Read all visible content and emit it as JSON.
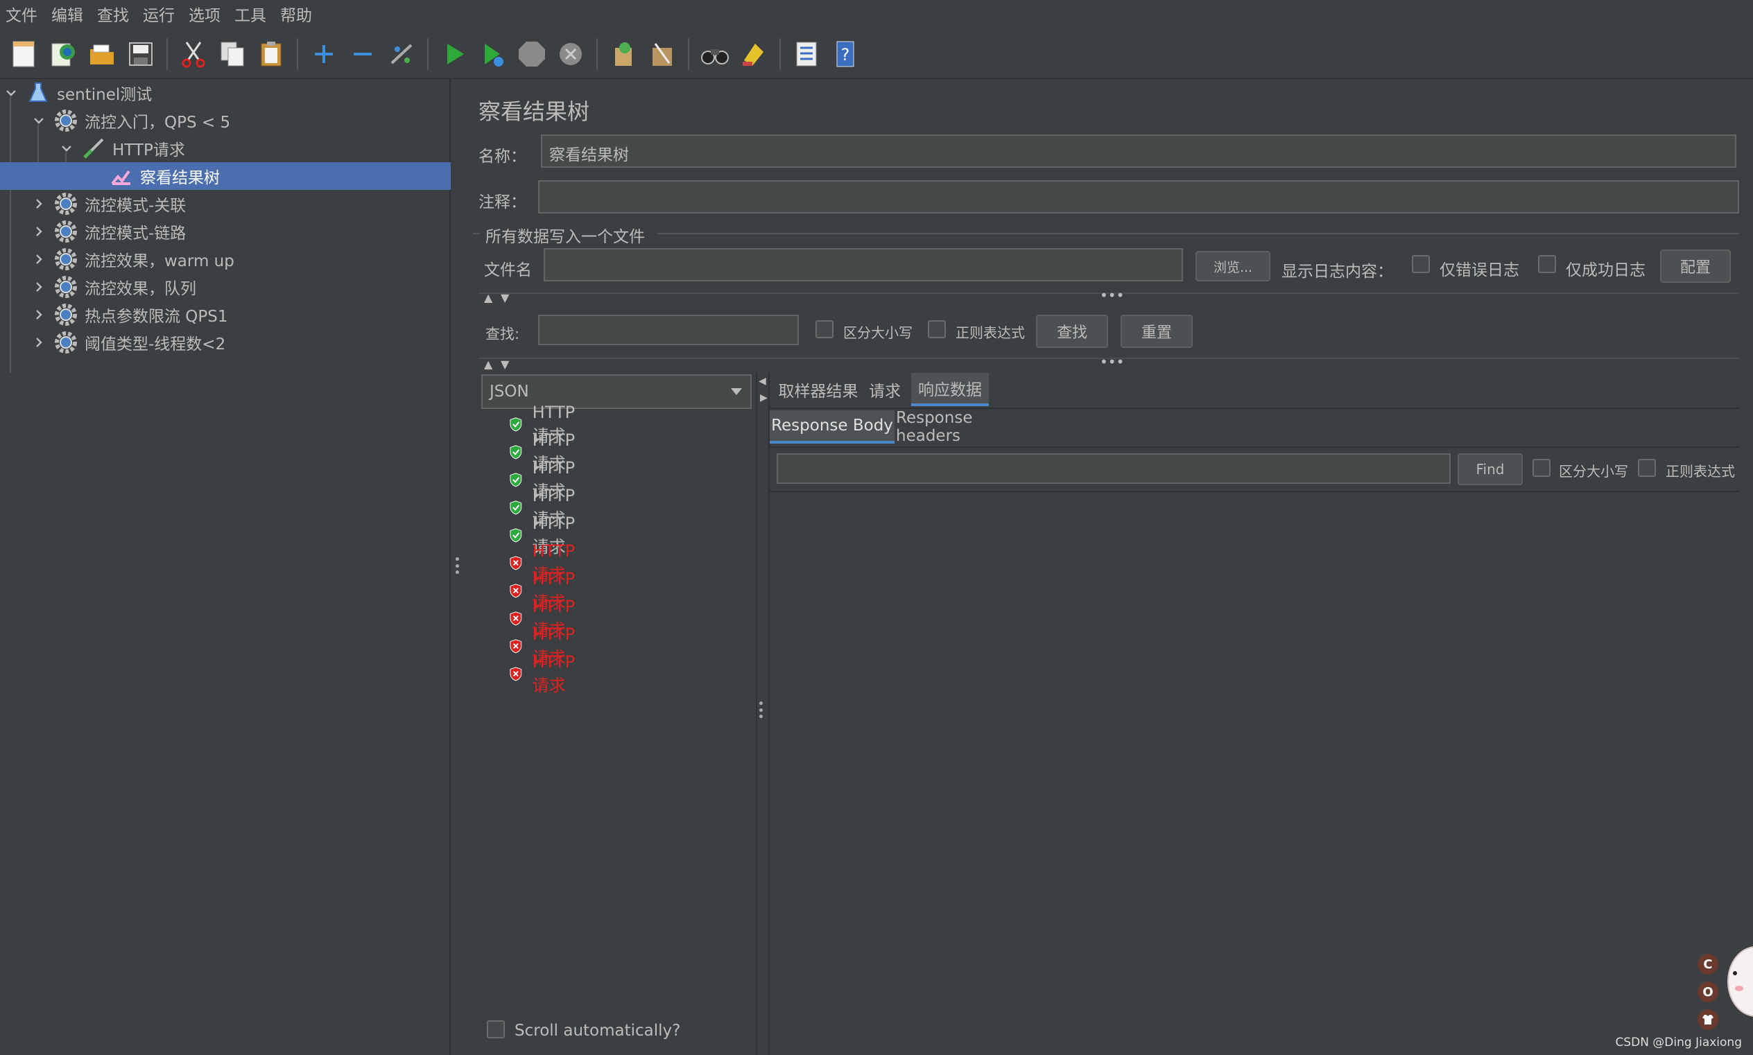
{
  "menu": [
    "文件",
    "编辑",
    "查找",
    "运行",
    "选项",
    "工具",
    "帮助"
  ],
  "toolbar": {
    "icons": [
      "new-icon",
      "templates-icon",
      "open-icon",
      "save-icon",
      "cut-icon",
      "copy-icon",
      "paste-icon",
      "expand-icon",
      "collapse-icon",
      "toggle-icon",
      "start-icon",
      "start-no-pause-icon",
      "stop-icon",
      "shutdown-icon",
      "clear-icon",
      "clear-all-icon",
      "search-icon",
      "reset-search-icon",
      "function-helper-icon",
      "help-icon"
    ]
  },
  "tree": {
    "items": [
      {
        "label": "sentinel测试",
        "level": 0,
        "expanded": true,
        "icon": "test-plan-icon"
      },
      {
        "label": "流控入门，QPS < 5",
        "level": 1,
        "expanded": true,
        "icon": "thread-group-icon"
      },
      {
        "label": "HTTP请求",
        "level": 2,
        "expanded": true,
        "icon": "sampler-icon"
      },
      {
        "label": "察看结果树",
        "level": 3,
        "selected": true,
        "icon": "listener-icon"
      },
      {
        "label": "流控模式-关联",
        "level": 1,
        "expanded": false,
        "icon": "thread-group-icon"
      },
      {
        "label": "流控模式-链路",
        "level": 1,
        "expanded": false,
        "icon": "thread-group-icon"
      },
      {
        "label": "流控效果，warm up",
        "level": 1,
        "expanded": false,
        "icon": "thread-group-icon"
      },
      {
        "label": "流控效果，队列",
        "level": 1,
        "expanded": false,
        "icon": "thread-group-icon"
      },
      {
        "label": "热点参数限流 QPS1",
        "level": 1,
        "expanded": false,
        "icon": "thread-group-icon"
      },
      {
        "label": "阈值类型-线程数<2",
        "level": 1,
        "expanded": false,
        "icon": "thread-group-icon"
      }
    ]
  },
  "panel": {
    "title": "察看结果树",
    "name_label": "名称：",
    "name_value": "察看结果树",
    "comment_label": "注释：",
    "comment_value": "",
    "file_group_label": "所有数据写入一个文件",
    "filename_label": "文件名",
    "filename_value": "",
    "browse_label": "浏览...",
    "log_display_label": "显示日志内容：",
    "errors_only_label": "仅错误日志",
    "success_only_label": "仅成功日志",
    "configure_label": "配置",
    "search_label": "查找:",
    "search_value": "",
    "case_sensitive_label": "区分大小写",
    "regex_label": "正则表达式",
    "find_label": "查找",
    "reset_label": "重置"
  },
  "results": {
    "renderer": "JSON",
    "items": [
      {
        "label": "HTTP请求",
        "status": "success"
      },
      {
        "label": "HTTP请求",
        "status": "success"
      },
      {
        "label": "HTTP请求",
        "status": "success"
      },
      {
        "label": "HTTP请求",
        "status": "success"
      },
      {
        "label": "HTTP请求",
        "status": "success"
      },
      {
        "label": "HTTP请求",
        "status": "error"
      },
      {
        "label": "HTTP请求",
        "status": "error"
      },
      {
        "label": "HTTP请求",
        "status": "error"
      },
      {
        "label": "HTTP请求",
        "status": "error"
      },
      {
        "label": "HTTP请求",
        "status": "error"
      }
    ],
    "scroll_label": "Scroll automatically?"
  },
  "detail": {
    "tabs": [
      "取样器结果",
      "请求",
      "响应数据"
    ],
    "active_tab": "响应数据",
    "subtabs": [
      "Response Body",
      "Response headers"
    ],
    "active_subtab": "Response Body",
    "find_value": "",
    "find_label": "Find",
    "case_sensitive_label": "区分大小写",
    "regex_label": "正则表达式"
  },
  "watermark": "CSDN @Ding Jiaxiong",
  "colors": {
    "background": "#3c3f41",
    "selection": "#4b6eaf",
    "success": "#2eaa3a",
    "error": "#e02020"
  }
}
